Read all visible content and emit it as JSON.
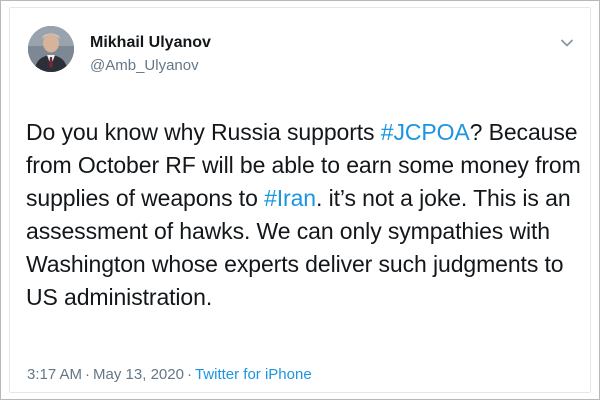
{
  "tweet": {
    "author": {
      "name": "Mikhail Ulyanov",
      "handle": "@Amb_Ulyanov"
    },
    "menu_icon": "chevron-down-icon",
    "text_segments": {
      "l1a": "Do you know why Russia supports ",
      "l1tag": "#JCPOA",
      "l1b": "? Because",
      "l2": "from October RF will be able to earn some money from",
      "l3a": "supplies of weapons to ",
      "l3tag": "#Iran",
      "l3b": ". it’s not a joke. This is an",
      "l4": "assessment of hawks. We can only sympathies with",
      "l5": "Washington whose experts deliver such judgments to",
      "l6": "US administration."
    },
    "meta": {
      "time": "3:17 AM",
      "separator": "·",
      "date": "May 13, 2020",
      "source": "Twitter for iPhone"
    },
    "colors": {
      "link": "#1b95e0",
      "text": "#14171a",
      "secondary": "#657786"
    }
  }
}
